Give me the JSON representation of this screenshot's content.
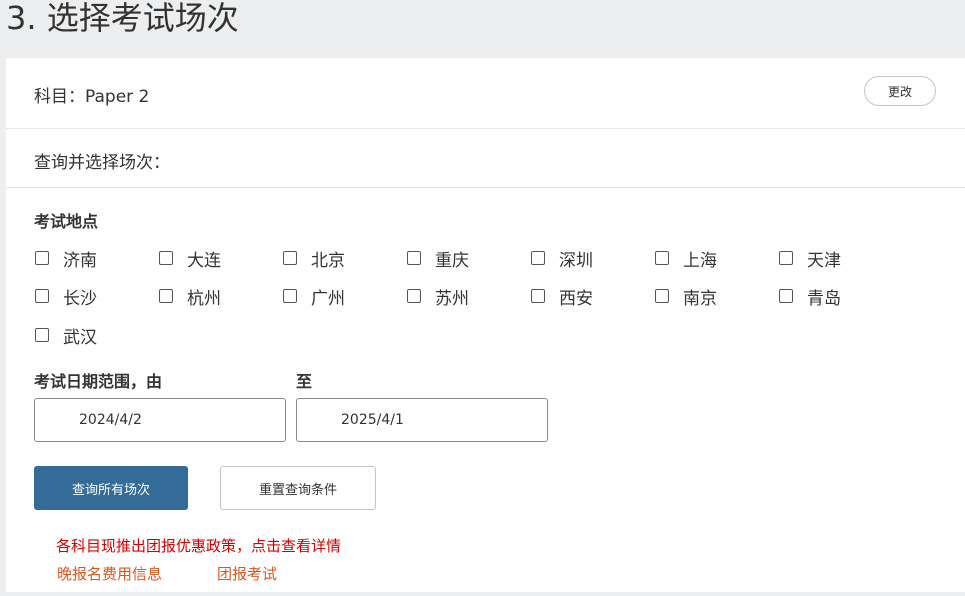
{
  "header": {
    "title": "3. 选择考试场次"
  },
  "subject": {
    "text": "科目：Paper 2",
    "change_label": "更改"
  },
  "query": {
    "text": "查询并选择场次："
  },
  "locations": {
    "label": "考试地点",
    "items": [
      {
        "label": "济南",
        "checked": false
      },
      {
        "label": "大连",
        "checked": false
      },
      {
        "label": "北京",
        "checked": false
      },
      {
        "label": "重庆",
        "checked": false
      },
      {
        "label": "深圳",
        "checked": false
      },
      {
        "label": "上海",
        "checked": false
      },
      {
        "label": "天津",
        "checked": false
      },
      {
        "label": "长沙",
        "checked": false
      },
      {
        "label": "杭州",
        "checked": false
      },
      {
        "label": "广州",
        "checked": false
      },
      {
        "label": "苏州",
        "checked": false
      },
      {
        "label": "西安",
        "checked": false
      },
      {
        "label": "南京",
        "checked": false
      },
      {
        "label": "青岛",
        "checked": false
      },
      {
        "label": "武汉",
        "checked": false
      }
    ]
  },
  "date_range": {
    "from_label": "考试日期范围，由",
    "to_label": "至",
    "from_value": "2024/4/2",
    "to_value": "2025/4/1"
  },
  "actions": {
    "search_label": "查询所有场次",
    "reset_label": "重置查询条件"
  },
  "links": {
    "promo": "各科目现推出团报优惠政策，点击查看详情",
    "late_fee": "晚报名费用信息",
    "group_exam": "团报考试"
  }
}
